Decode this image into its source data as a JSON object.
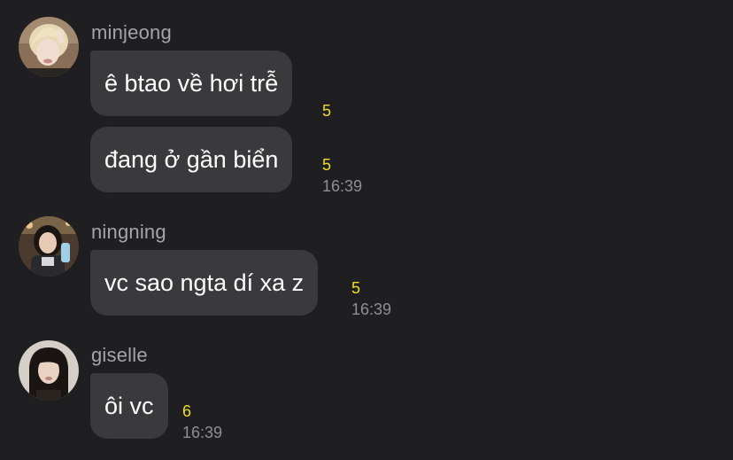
{
  "colors": {
    "background": "#1f1f21",
    "bubble": "#3a3a3d",
    "sender_name": "#a5a5a8",
    "unread_count": "#f2dd1c",
    "timestamp": "#8f8f93"
  },
  "chat": {
    "groups": [
      {
        "sender": "minjeong",
        "messages": [
          {
            "text": "ê btao về hơi trễ",
            "count": "5",
            "time": ""
          },
          {
            "text": "đang ở gần biển",
            "count": "5",
            "time": "16:39"
          }
        ]
      },
      {
        "sender": "ningning",
        "messages": [
          {
            "text": "vc sao ngta dí xa z",
            "count": "5",
            "time": "16:39"
          }
        ]
      },
      {
        "sender": "giselle",
        "messages": [
          {
            "text": "ôi vc",
            "count": "6",
            "time": "16:39"
          }
        ]
      }
    ]
  }
}
